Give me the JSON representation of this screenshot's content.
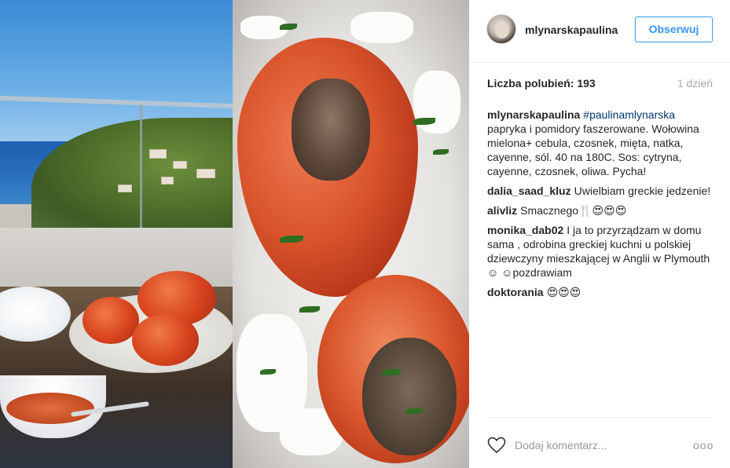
{
  "post": {
    "username": "mlynarskapaulina",
    "follow_label": "Obserwuj",
    "likes_label": "Liczba polubień: 193",
    "time_ago": "1 dzień"
  },
  "photo": {
    "description_icon": "photo-collage",
    "colors": {
      "sky": "#4a98dc",
      "sea": "#2366b6",
      "pepper": "#d9542b",
      "rice": "#f3f3f1"
    }
  },
  "comments": [
    {
      "user": "mlynarskapaulina",
      "tag": "#paulinamlynarska",
      "text": "papryka i pomidory faszerowane. Wołowina mielona+ cebula, czosnek, mięta, natka, cayenne, sól. 40 na 180C. Sos: cytryna, cayenne, czosnek, oliwa. Pycha!"
    },
    {
      "user": "dalia_saad_kluz",
      "text": "Uwielbiam greckie jedzenie!"
    },
    {
      "user": "alivliz",
      "text": "Smacznego🍴😍😍😍"
    },
    {
      "user": "monika_dab02",
      "text": "I ja to przyrządzam w domu sama , odrobina greckiej kuchni u polskiej dziewczyny mieszkającej w Anglii w Plymouth ☺ ☺pozdrawiam"
    },
    {
      "user": "doktorania",
      "text": "😍😍😍"
    }
  ],
  "footer": {
    "comment_placeholder": "Dodaj komentarz...",
    "more_label": "ooo",
    "like_icon": "heart-outline-icon",
    "more_icon": "ellipsis-icon"
  },
  "colors": {
    "accent": "#3897f0",
    "text": "#262626",
    "muted": "#a5a7aa",
    "border": "#efefef"
  }
}
